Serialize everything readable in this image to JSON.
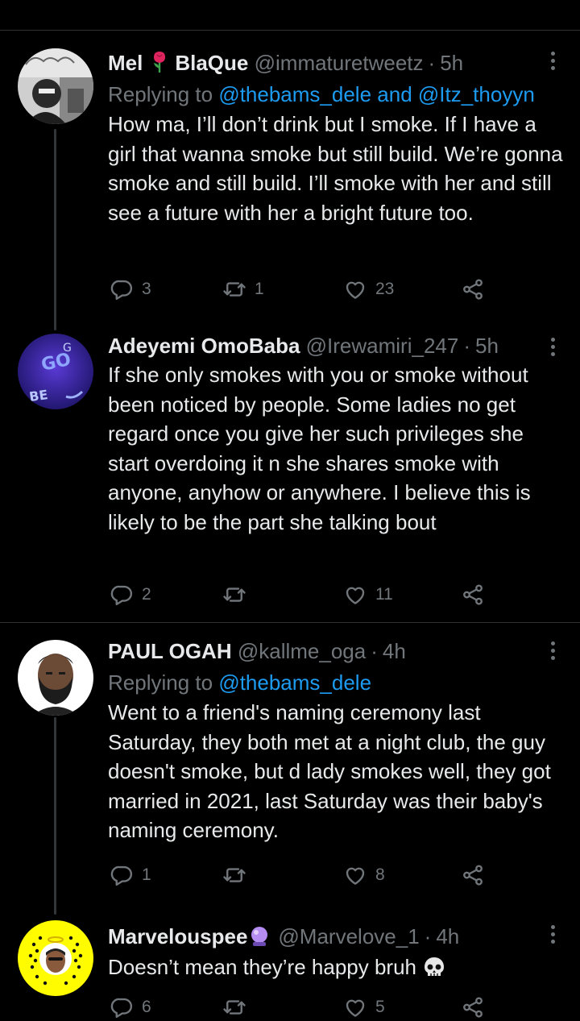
{
  "tweets": [
    {
      "name": "Mel",
      "name2": "BlaQue",
      "handle": "@immaturetweetz",
      "time": "5h",
      "reply_prefix": "Replying to",
      "reply_mentions": "@thebams_dele and @Itz_thoyyn",
      "text": "How ma, I’ll don’t drink but I smoke. If I have a girl that wanna smoke but still build. We’re gonna smoke and still build. I’ll smoke with her and still see a future with her a bright future too.",
      "replies": "3",
      "retweets": "1",
      "likes": "23",
      "avatar_icon": "profile-photo-icon"
    },
    {
      "name": "Adeyemi OmoBaba",
      "handle": "@Irewamiri_247",
      "time": "5h",
      "text": "If she only smokes with you or smoke without been noticed by people. Some ladies no get regard once you give her such privileges she start overdoing it n she shares smoke with anyone, anyhow or anywhere. I believe this is likely to be the part she talking bout",
      "replies": "2",
      "retweets": "",
      "likes": "11",
      "avatar_icon": "graffiti-avatar-icon"
    },
    {
      "name": "PAUL OGAH",
      "handle": "@kallme_oga",
      "time": "4h",
      "reply_prefix": "Replying to",
      "reply_mentions": "@thebams_dele",
      "text": "Went to a friend's naming ceremony last Saturday, they both met at a night club, the guy doesn't smoke, but d lady smokes well, they got married in 2021, last Saturday was their baby's naming ceremony.",
      "replies": "1",
      "retweets": "",
      "likes": "8",
      "avatar_icon": "bearded-man-avatar-icon"
    },
    {
      "name": "Marvelouspee",
      "handle": "@Marvelove_1",
      "time": "4h",
      "text": "Doesn’t mean they’re happy bruh",
      "replies": "6",
      "retweets": "",
      "likes": "5",
      "avatar_icon": "snapcode-avatar-icon"
    }
  ],
  "separator": "·",
  "colors": {
    "background": "#000000",
    "text": "#e7e9ea",
    "muted": "#71767b",
    "link": "#1d9bf0",
    "divider": "#2f3336"
  }
}
